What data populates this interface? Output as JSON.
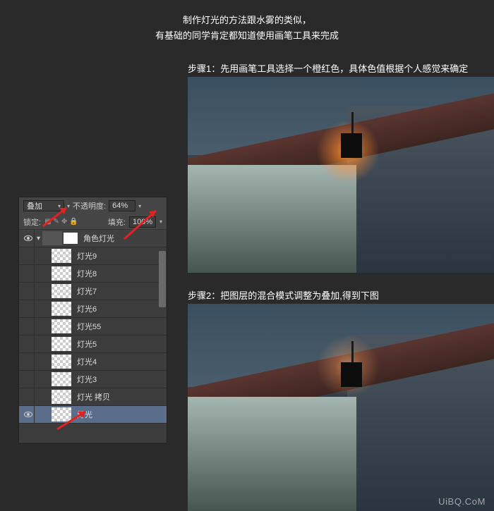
{
  "header": {
    "line1": "制作灯光的方法跟水雾的类似，",
    "line2": "有基础的同学肯定都知道使用画笔工具来完成"
  },
  "steps": {
    "step1": "步骤1：先用画笔工具选择一个橙红色，具体色值根据个人感觉来确定",
    "step2": "步骤2：把图层的混合模式调整为叠加,得到下图"
  },
  "panel": {
    "blend_mode": "叠加",
    "opacity_label": "不透明度:",
    "opacity_value": "64%",
    "lock_label": "锁定:",
    "fill_label": "填充:",
    "fill_value": "100%",
    "group_name": "角色灯光",
    "layers": [
      {
        "name": "灯光9",
        "visible": false
      },
      {
        "name": "灯光8",
        "visible": false
      },
      {
        "name": "灯光7",
        "visible": false
      },
      {
        "name": "灯光6",
        "visible": false
      },
      {
        "name": "灯光55",
        "visible": false
      },
      {
        "name": "灯光5",
        "visible": false
      },
      {
        "name": "灯光4",
        "visible": false
      },
      {
        "name": "灯光3",
        "visible": false
      },
      {
        "name": "灯光 拷贝",
        "visible": false
      },
      {
        "name": "灯光",
        "visible": true,
        "selected": true
      }
    ]
  },
  "watermark": "UiBQ.CoM"
}
